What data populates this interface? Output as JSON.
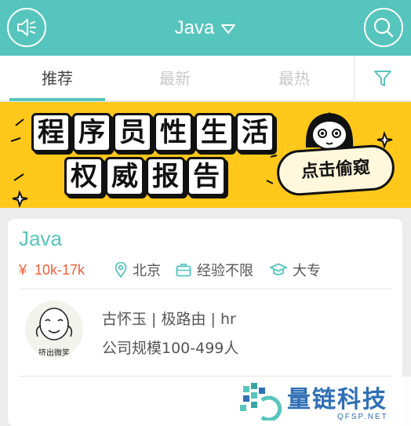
{
  "header": {
    "title": "Java",
    "speaker_icon": "speaker-icon",
    "search_icon": "search-icon",
    "caret_icon": "caret-down-icon"
  },
  "tabs": [
    {
      "label": "推荐",
      "active": true
    },
    {
      "label": "最新",
      "active": false
    },
    {
      "label": "最热",
      "active": false
    }
  ],
  "filter_icon": "filter-icon",
  "banner": {
    "line1": [
      "程",
      "序",
      "员",
      "性",
      "生",
      "活"
    ],
    "line2": [
      "权",
      "威",
      "报",
      "告"
    ],
    "badge": "点击偷窥"
  },
  "job": {
    "title": "Java",
    "salary_symbol": "¥",
    "salary": "10k-17k",
    "city": "北京",
    "experience": "经验不限",
    "education": "大专",
    "company": "古怀玉 | 极路由 | hr",
    "scale": "公司规模100-499人",
    "avatar_caption": "挤出微笑"
  },
  "watermark": {
    "name": "量链科技",
    "domain": "QFSP.NET"
  },
  "colors": {
    "primary": "#56c5bd",
    "salary": "#f25f3a",
    "banner": "#ffc81b"
  }
}
